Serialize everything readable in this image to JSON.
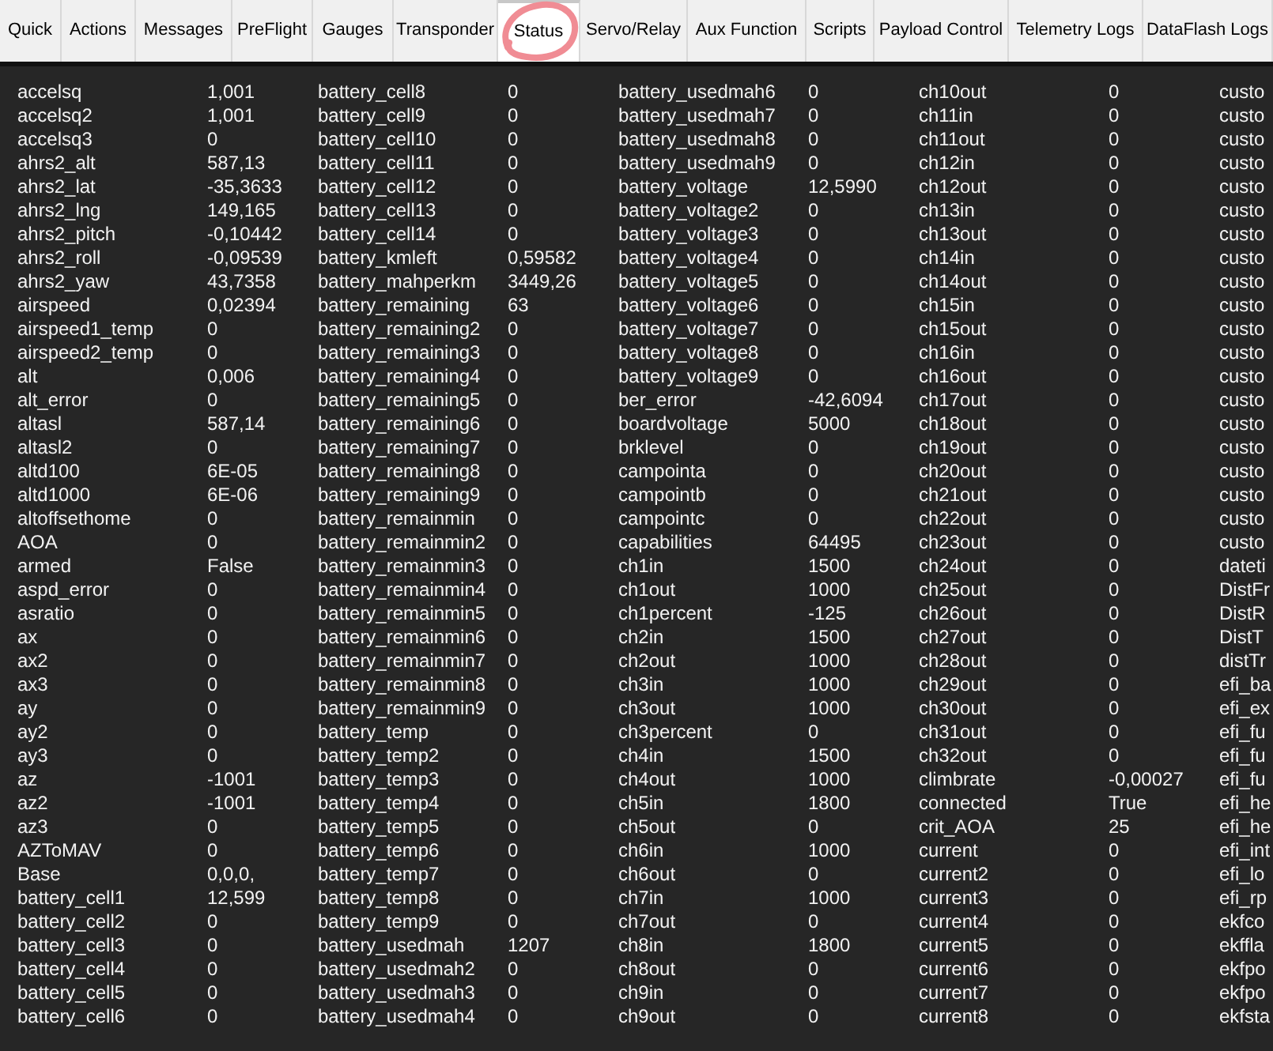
{
  "tabs": [
    {
      "label": "Quick",
      "selected": false
    },
    {
      "label": "Actions",
      "selected": false
    },
    {
      "label": "Messages",
      "selected": false
    },
    {
      "label": "PreFlight",
      "selected": false
    },
    {
      "label": "Gauges",
      "selected": false
    },
    {
      "label": "Transponder",
      "selected": false
    },
    {
      "label": "Status",
      "selected": true
    },
    {
      "label": "Servo/Relay",
      "selected": false
    },
    {
      "label": "Aux Function",
      "selected": false
    },
    {
      "label": "Scripts",
      "selected": false
    },
    {
      "label": "Payload Control",
      "selected": false
    },
    {
      "label": "Telemetry Logs",
      "selected": false
    },
    {
      "label": "DataFlash Logs",
      "selected": false
    }
  ],
  "annotation": {
    "kind": "circle",
    "color": "#f08c94"
  },
  "columns": [
    {
      "items": [
        {
          "name": "accelsq",
          "value": "1,001"
        },
        {
          "name": "accelsq2",
          "value": "1,001"
        },
        {
          "name": "accelsq3",
          "value": "0"
        },
        {
          "name": "ahrs2_alt",
          "value": "587,13"
        },
        {
          "name": "ahrs2_lat",
          "value": "-35,3633"
        },
        {
          "name": "ahrs2_lng",
          "value": "149,165"
        },
        {
          "name": "ahrs2_pitch",
          "value": "-0,10442"
        },
        {
          "name": "ahrs2_roll",
          "value": "-0,09539"
        },
        {
          "name": "ahrs2_yaw",
          "value": "43,7358"
        },
        {
          "name": "airspeed",
          "value": "0,02394"
        },
        {
          "name": "airspeed1_temp",
          "value": "0"
        },
        {
          "name": "airspeed2_temp",
          "value": "0"
        },
        {
          "name": "alt",
          "value": "0,006"
        },
        {
          "name": "alt_error",
          "value": "0"
        },
        {
          "name": "altasl",
          "value": "587,14"
        },
        {
          "name": "altasl2",
          "value": "0"
        },
        {
          "name": "altd100",
          "value": "6E-05"
        },
        {
          "name": "altd1000",
          "value": "6E-06"
        },
        {
          "name": "altoffsethome",
          "value": "0"
        },
        {
          "name": "AOA",
          "value": "0"
        },
        {
          "name": "armed",
          "value": "False"
        },
        {
          "name": "aspd_error",
          "value": "0"
        },
        {
          "name": "asratio",
          "value": "0"
        },
        {
          "name": "ax",
          "value": "0"
        },
        {
          "name": "ax2",
          "value": "0"
        },
        {
          "name": "ax3",
          "value": "0"
        },
        {
          "name": "ay",
          "value": "0"
        },
        {
          "name": "ay2",
          "value": "0"
        },
        {
          "name": "ay3",
          "value": "0"
        },
        {
          "name": "az",
          "value": "-1001"
        },
        {
          "name": "az2",
          "value": "-1001"
        },
        {
          "name": "az3",
          "value": "0"
        },
        {
          "name": "AZToMAV",
          "value": "0"
        },
        {
          "name": "Base",
          "value": "0,0,0,"
        },
        {
          "name": "battery_cell1",
          "value": "12,599"
        },
        {
          "name": "battery_cell2",
          "value": "0"
        },
        {
          "name": "battery_cell3",
          "value": "0"
        },
        {
          "name": "battery_cell4",
          "value": "0"
        },
        {
          "name": "battery_cell5",
          "value": "0"
        },
        {
          "name": "battery_cell6",
          "value": "0"
        }
      ]
    },
    {
      "items": [
        {
          "name": "battery_cell8",
          "value": "0"
        },
        {
          "name": "battery_cell9",
          "value": "0"
        },
        {
          "name": "battery_cell10",
          "value": "0"
        },
        {
          "name": "battery_cell11",
          "value": "0"
        },
        {
          "name": "battery_cell12",
          "value": "0"
        },
        {
          "name": "battery_cell13",
          "value": "0"
        },
        {
          "name": "battery_cell14",
          "value": "0"
        },
        {
          "name": "battery_kmleft",
          "value": "0,59582"
        },
        {
          "name": "battery_mahperkm",
          "value": "3449,26"
        },
        {
          "name": "battery_remaining",
          "value": "63"
        },
        {
          "name": "battery_remaining2",
          "value": "0"
        },
        {
          "name": "battery_remaining3",
          "value": "0"
        },
        {
          "name": "battery_remaining4",
          "value": "0"
        },
        {
          "name": "battery_remaining5",
          "value": "0"
        },
        {
          "name": "battery_remaining6",
          "value": "0"
        },
        {
          "name": "battery_remaining7",
          "value": "0"
        },
        {
          "name": "battery_remaining8",
          "value": "0"
        },
        {
          "name": "battery_remaining9",
          "value": "0"
        },
        {
          "name": "battery_remainmin",
          "value": "0"
        },
        {
          "name": "battery_remainmin2",
          "value": "0"
        },
        {
          "name": "battery_remainmin3",
          "value": "0"
        },
        {
          "name": "battery_remainmin4",
          "value": "0"
        },
        {
          "name": "battery_remainmin5",
          "value": "0"
        },
        {
          "name": "battery_remainmin6",
          "value": "0"
        },
        {
          "name": "battery_remainmin7",
          "value": "0"
        },
        {
          "name": "battery_remainmin8",
          "value": "0"
        },
        {
          "name": "battery_remainmin9",
          "value": "0"
        },
        {
          "name": "battery_temp",
          "value": "0"
        },
        {
          "name": "battery_temp2",
          "value": "0"
        },
        {
          "name": "battery_temp3",
          "value": "0"
        },
        {
          "name": "battery_temp4",
          "value": "0"
        },
        {
          "name": "battery_temp5",
          "value": "0"
        },
        {
          "name": "battery_temp6",
          "value": "0"
        },
        {
          "name": "battery_temp7",
          "value": "0"
        },
        {
          "name": "battery_temp8",
          "value": "0"
        },
        {
          "name": "battery_temp9",
          "value": "0"
        },
        {
          "name": "battery_usedmah",
          "value": "1207"
        },
        {
          "name": "battery_usedmah2",
          "value": "0"
        },
        {
          "name": "battery_usedmah3",
          "value": "0"
        },
        {
          "name": "battery_usedmah4",
          "value": "0"
        }
      ]
    },
    {
      "items": [
        {
          "name": "battery_usedmah6",
          "value": "0"
        },
        {
          "name": "battery_usedmah7",
          "value": "0"
        },
        {
          "name": "battery_usedmah8",
          "value": "0"
        },
        {
          "name": "battery_usedmah9",
          "value": "0"
        },
        {
          "name": "battery_voltage",
          "value": "12,5990"
        },
        {
          "name": "battery_voltage2",
          "value": "0"
        },
        {
          "name": "battery_voltage3",
          "value": "0"
        },
        {
          "name": "battery_voltage4",
          "value": "0"
        },
        {
          "name": "battery_voltage5",
          "value": "0"
        },
        {
          "name": "battery_voltage6",
          "value": "0"
        },
        {
          "name": "battery_voltage7",
          "value": "0"
        },
        {
          "name": "battery_voltage8",
          "value": "0"
        },
        {
          "name": "battery_voltage9",
          "value": "0"
        },
        {
          "name": "ber_error",
          "value": "-42,6094"
        },
        {
          "name": "boardvoltage",
          "value": "5000"
        },
        {
          "name": "brklevel",
          "value": "0"
        },
        {
          "name": "campointa",
          "value": "0"
        },
        {
          "name": "campointb",
          "value": "0"
        },
        {
          "name": "campointc",
          "value": "0"
        },
        {
          "name": "capabilities",
          "value": "64495"
        },
        {
          "name": "ch1in",
          "value": "1500"
        },
        {
          "name": "ch1out",
          "value": "1000"
        },
        {
          "name": "ch1percent",
          "value": "-125"
        },
        {
          "name": "ch2in",
          "value": "1500"
        },
        {
          "name": "ch2out",
          "value": "1000"
        },
        {
          "name": "ch3in",
          "value": "1000"
        },
        {
          "name": "ch3out",
          "value": "1000"
        },
        {
          "name": "ch3percent",
          "value": "0"
        },
        {
          "name": "ch4in",
          "value": "1500"
        },
        {
          "name": "ch4out",
          "value": "1000"
        },
        {
          "name": "ch5in",
          "value": "1800"
        },
        {
          "name": "ch5out",
          "value": "0"
        },
        {
          "name": "ch6in",
          "value": "1000"
        },
        {
          "name": "ch6out",
          "value": "0"
        },
        {
          "name": "ch7in",
          "value": "1000"
        },
        {
          "name": "ch7out",
          "value": "0"
        },
        {
          "name": "ch8in",
          "value": "1800"
        },
        {
          "name": "ch8out",
          "value": "0"
        },
        {
          "name": "ch9in",
          "value": "0"
        },
        {
          "name": "ch9out",
          "value": "0"
        }
      ]
    },
    {
      "items": [
        {
          "name": "ch10out",
          "value": "0"
        },
        {
          "name": "ch11in",
          "value": "0"
        },
        {
          "name": "ch11out",
          "value": "0"
        },
        {
          "name": "ch12in",
          "value": "0"
        },
        {
          "name": "ch12out",
          "value": "0"
        },
        {
          "name": "ch13in",
          "value": "0"
        },
        {
          "name": "ch13out",
          "value": "0"
        },
        {
          "name": "ch14in",
          "value": "0"
        },
        {
          "name": "ch14out",
          "value": "0"
        },
        {
          "name": "ch15in",
          "value": "0"
        },
        {
          "name": "ch15out",
          "value": "0"
        },
        {
          "name": "ch16in",
          "value": "0"
        },
        {
          "name": "ch16out",
          "value": "0"
        },
        {
          "name": "ch17out",
          "value": "0"
        },
        {
          "name": "ch18out",
          "value": "0"
        },
        {
          "name": "ch19out",
          "value": "0"
        },
        {
          "name": "ch20out",
          "value": "0"
        },
        {
          "name": "ch21out",
          "value": "0"
        },
        {
          "name": "ch22out",
          "value": "0"
        },
        {
          "name": "ch23out",
          "value": "0"
        },
        {
          "name": "ch24out",
          "value": "0"
        },
        {
          "name": "ch25out",
          "value": "0"
        },
        {
          "name": "ch26out",
          "value": "0"
        },
        {
          "name": "ch27out",
          "value": "0"
        },
        {
          "name": "ch28out",
          "value": "0"
        },
        {
          "name": "ch29out",
          "value": "0"
        },
        {
          "name": "ch30out",
          "value": "0"
        },
        {
          "name": "ch31out",
          "value": "0"
        },
        {
          "name": "ch32out",
          "value": "0"
        },
        {
          "name": "climbrate",
          "value": "-0,00027"
        },
        {
          "name": "connected",
          "value": "True"
        },
        {
          "name": "crit_AOA",
          "value": "25"
        },
        {
          "name": "current",
          "value": "0"
        },
        {
          "name": "current2",
          "value": "0"
        },
        {
          "name": "current3",
          "value": "0"
        },
        {
          "name": "current4",
          "value": "0"
        },
        {
          "name": "current5",
          "value": "0"
        },
        {
          "name": "current6",
          "value": "0"
        },
        {
          "name": "current7",
          "value": "0"
        },
        {
          "name": "current8",
          "value": "0"
        }
      ]
    },
    {
      "items": [
        {
          "name": "custo"
        },
        {
          "name": "custo"
        },
        {
          "name": "custo"
        },
        {
          "name": "custo"
        },
        {
          "name": "custo"
        },
        {
          "name": "custo"
        },
        {
          "name": "custo"
        },
        {
          "name": "custo"
        },
        {
          "name": "custo"
        },
        {
          "name": "custo"
        },
        {
          "name": "custo"
        },
        {
          "name": "custo"
        },
        {
          "name": "custo"
        },
        {
          "name": "custo"
        },
        {
          "name": "custo"
        },
        {
          "name": "custo"
        },
        {
          "name": "custo"
        },
        {
          "name": "custo"
        },
        {
          "name": "custo"
        },
        {
          "name": "custo"
        },
        {
          "name": "dateti"
        },
        {
          "name": "DistFr"
        },
        {
          "name": "DistR"
        },
        {
          "name": "DistT"
        },
        {
          "name": "distTr"
        },
        {
          "name": "efi_ba"
        },
        {
          "name": "efi_ex"
        },
        {
          "name": "efi_fu"
        },
        {
          "name": "efi_fu"
        },
        {
          "name": "efi_fu"
        },
        {
          "name": "efi_he"
        },
        {
          "name": "efi_he"
        },
        {
          "name": "efi_int"
        },
        {
          "name": "efi_lo"
        },
        {
          "name": "efi_rp"
        },
        {
          "name": "ekfco"
        },
        {
          "name": "ekffla"
        },
        {
          "name": "ekfpo"
        },
        {
          "name": "ekfpo"
        },
        {
          "name": "ekfsta"
        }
      ]
    }
  ]
}
